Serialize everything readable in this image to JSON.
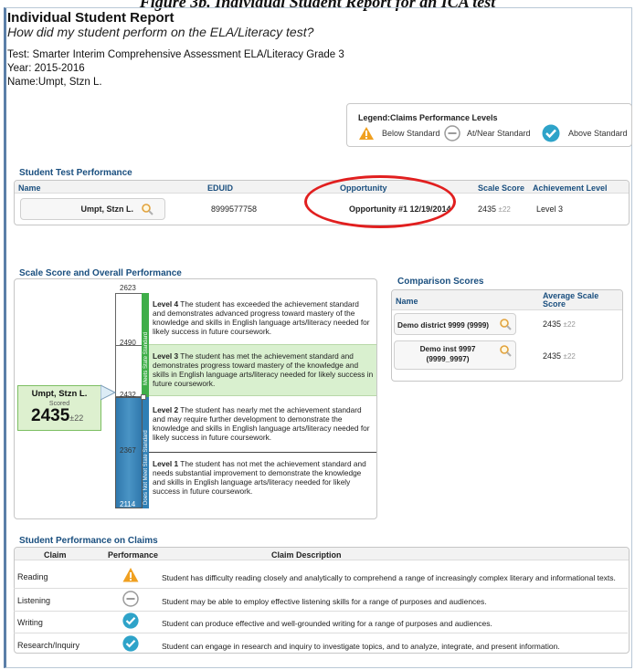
{
  "caption": "Figure 3b. Individual Student Report for an ICA test",
  "header": {
    "title": "Individual Student Report",
    "subtitle": "How did my student perform on the ELA/Literacy test?",
    "test_line": "Test:  Smarter Interim Comprehensive Assessment ELA/Literacy Grade 3",
    "year_line": "Year:  2015-2016",
    "name_line": "Name:Umpt, Stzn L."
  },
  "legend": {
    "title": "Legend:Claims Performance Levels",
    "below": "Below Standard",
    "near": "At/Near Standard",
    "above": "Above Standard"
  },
  "test_performance": {
    "section_title": "Student Test Performance",
    "columns": [
      "Name",
      "EDUID",
      "Opportunity",
      "Scale Score",
      "Achievement Level"
    ],
    "row": {
      "name": "Umpt, Stzn L.",
      "eduid": "8999577758",
      "opportunity": "Opportunity #1 12/19/2014",
      "scale_score": "2435",
      "scale_err": "±22",
      "achievement": "Level 3"
    }
  },
  "scale": {
    "section_title": "Scale Score and Overall Performance",
    "cut_scores": [
      "2623",
      "2490",
      "2432",
      "2367",
      "2114"
    ],
    "bar_label_top": "Meets State Standard",
    "bar_label_bottom": "Does Not Meet State Standard",
    "student_name": "Umpt, Stzn L.",
    "scored_label": "Scored",
    "score": "2435",
    "score_err": "±22",
    "levels": [
      {
        "heading": "Level 4",
        "text": "The student has exceeded the achievement standard and demonstrates advanced progress toward mastery of the knowledge and skills in English language arts/literacy needed for likely success in future coursework."
      },
      {
        "heading": "Level 3",
        "text": "The student has met the achievement standard and demonstrates progress toward mastery of the knowledge and skills in English language arts/literacy needed for likely success in future coursework."
      },
      {
        "heading": "Level 2",
        "text": "The student has nearly met the achievement standard and may require further development to demonstrate the knowledge and skills in English language arts/literacy needed for likely success in future coursework."
      },
      {
        "heading": "Level 1",
        "text": "The student has not met the achievement standard and needs substantial improvement to demonstrate the knowledge and skills in English language arts/literacy needed for likely success in future coursework."
      }
    ]
  },
  "comparison": {
    "section_title": "Comparison Scores",
    "col_name": "Name",
    "col_avg": "Average Scale Score",
    "rows": [
      {
        "name": "Demo district 9999 (9999)",
        "score": "2435",
        "err": "±22"
      },
      {
        "name": "Demo inst 9997 (9999_9997)",
        "score": "2435",
        "err": "±22"
      }
    ]
  },
  "claims": {
    "section_title": "Student Performance on Claims",
    "col_claim": "Claim",
    "col_perf": "Performance",
    "col_desc": "Claim Description",
    "rows": [
      {
        "claim": "Reading",
        "performance": "below",
        "desc": "Student has difficulty reading closely and analytically to comprehend a range of increasingly complex literary and informational texts."
      },
      {
        "claim": "Listening",
        "performance": "near",
        "desc": "Student may be able to employ effective listening skills for a range of purposes and audiences."
      },
      {
        "claim": "Writing",
        "performance": "above",
        "desc": "Student can produce effective and well-grounded writing for a range of purposes and audiences."
      },
      {
        "claim": "Research/Inquiry",
        "performance": "above",
        "desc": "Student can engage in research and inquiry to investigate topics, and to analyze, integrate, and present information."
      }
    ]
  },
  "colors": {
    "below": "#f0a020",
    "near": "#9a9a9a",
    "above": "#2ea3c9",
    "meets_bar": "#3fae49",
    "not_meets_bar": "#2f7fb5",
    "highlight": "#d9f0cf",
    "annotation": "#e11f1f"
  }
}
